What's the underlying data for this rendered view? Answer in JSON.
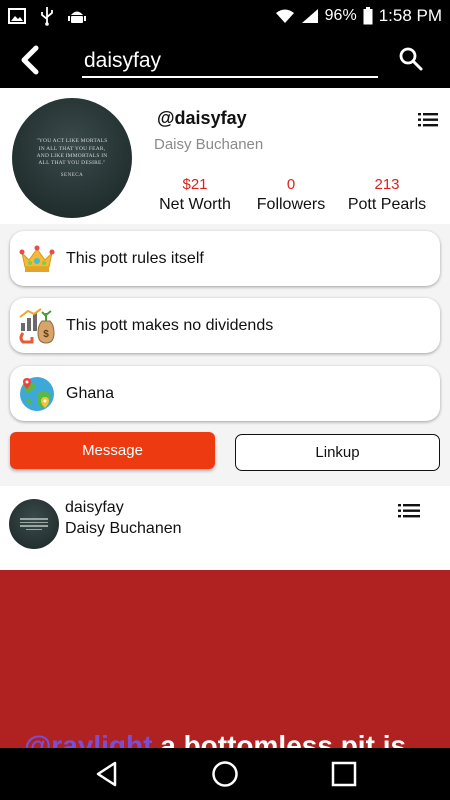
{
  "status_bar": {
    "battery": "96%",
    "time": "1:58 PM",
    "icons": [
      "image-icon",
      "usb-icon",
      "android-icon",
      "wifi-icon",
      "signal-icon",
      "battery-icon"
    ]
  },
  "search": {
    "value": "daisyfay",
    "back_icon": "back-arrow-icon",
    "search_icon": "search-icon"
  },
  "profile": {
    "handle": "@daisyfay",
    "display_name": "Daisy Buchanen",
    "avatar_quote": "\"YOU ACT LIKE MORTALS IN ALL THAT YOU FEAR, AND LIKE IMMORTALS IN ALL THAT YOU DESIRE.\"",
    "avatar_author": "SENECA",
    "stats": [
      {
        "value": "$21",
        "label": "Net Worth"
      },
      {
        "value": "0",
        "label": "Followers"
      },
      {
        "value": "213",
        "label": "Pott Pearls"
      }
    ]
  },
  "info_cards": [
    {
      "icon": "crown-icon",
      "text": "This pott rules itself"
    },
    {
      "icon": "dividends-icon",
      "text": "This pott makes no dividends"
    },
    {
      "icon": "globe-icon",
      "text": "Ghana"
    }
  ],
  "actions": {
    "message": "Message",
    "linkup": "Linkup"
  },
  "post": {
    "username": "daisyfay",
    "name": "Daisy Buchanen",
    "caption_mention": "@raylight",
    "caption_text": "a bottomless pit is"
  },
  "colors": {
    "accent_red": "#e0201b",
    "message_button": "#ee3a10",
    "post_background": "#b02222",
    "mention": "#7a4fd6"
  }
}
